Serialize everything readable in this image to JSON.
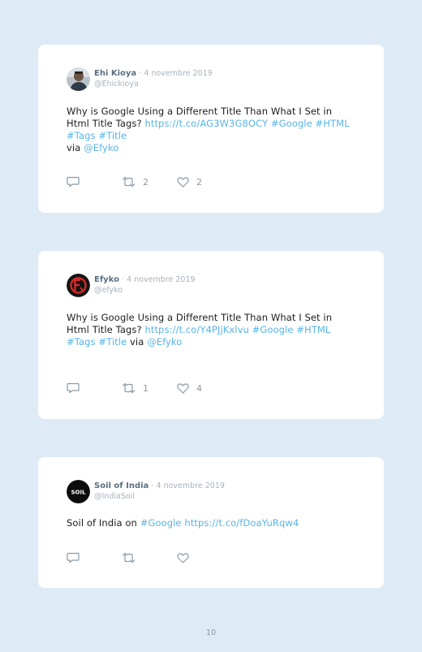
{
  "tweets": [
    {
      "name": "Ehi Kioya",
      "date": "· 4 novembre 2019",
      "handle": "@Ehickioya",
      "avatar_icon": "person-photo-avatar",
      "text_plain": "Why is Google Using a Different Title Than What I Set in Html Title Tags?",
      "link_url": "https://t.co/AG3W3G8OCY",
      "hashtags": "#Google #HTML #Tags #Title",
      "via": "via",
      "mention": "@Efyko",
      "retweets": "2",
      "likes": "2"
    },
    {
      "name": "Efyko",
      "date": "· 4 novembre 2019",
      "handle": "@efyko",
      "avatar_icon": "efyko-logo-avatar",
      "text_plain": "Why is Google Using a Different Title Than What I Set in Html Title Tags?",
      "link_url": "https://t.co/Y4PJjKxlvu",
      "hashtags": "#Google #HTML #Tags #Title",
      "via": "via",
      "mention": "@Efyko",
      "retweets": "1",
      "likes": "4"
    },
    {
      "name": "Soil of India",
      "date": "· 4 novembre 2019",
      "handle": "@IndiaSoil",
      "avatar_icon": "soil-logo-avatar",
      "avatar_text": "SOIL",
      "text_plain": "Soil of India on",
      "hashtag": "#Google",
      "link_url": "https://t.co/fDoaYuRqw4",
      "retweets": "",
      "likes": ""
    }
  ],
  "page_number": "10",
  "colors": {
    "background": "#deebf7",
    "card": "#ffffff",
    "link": "#58b4e6",
    "name": "#5b6f82",
    "muted": "#a6b2bd",
    "icon": "#8a99a8"
  }
}
